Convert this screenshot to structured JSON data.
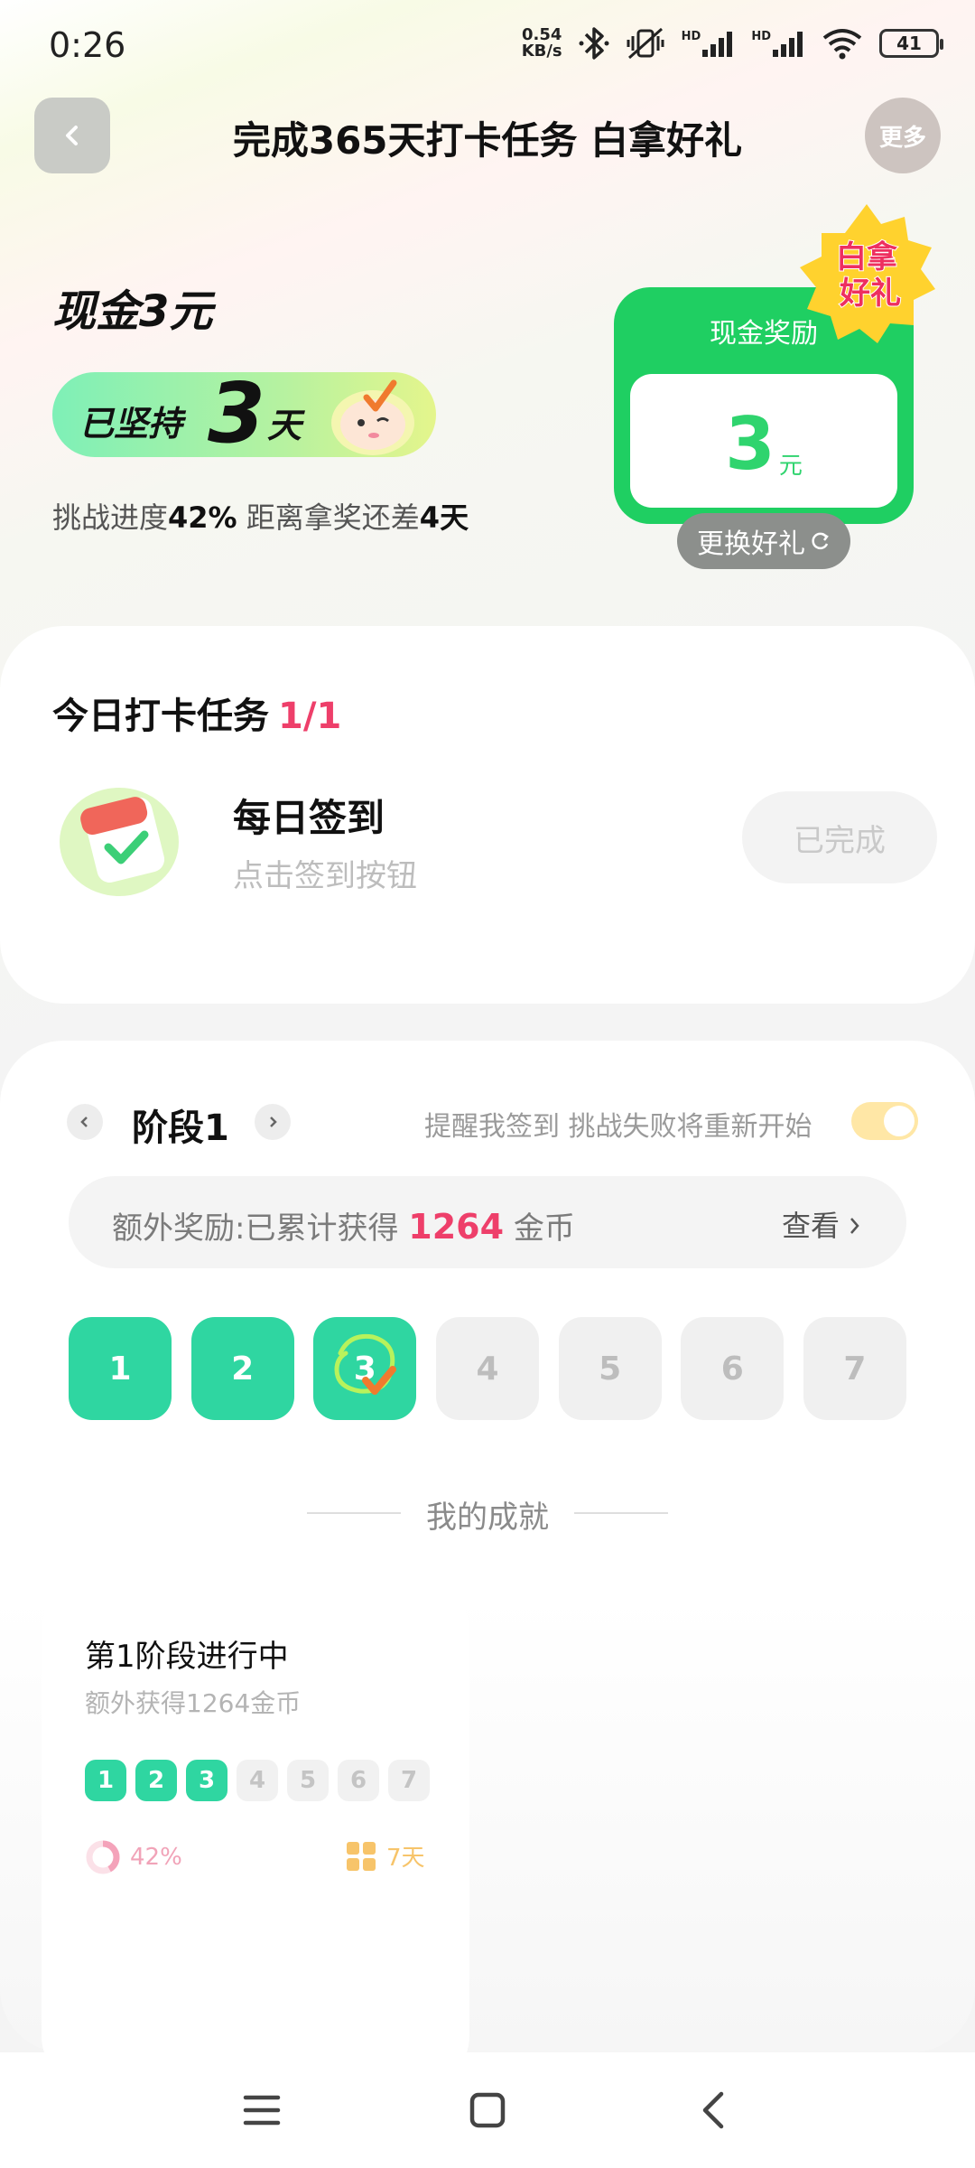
{
  "status_bar": {
    "time": "0:26",
    "net_speed_value": "0.54",
    "net_speed_unit": "KB/s",
    "hd1": "HD",
    "hd2": "HD",
    "battery": "41"
  },
  "header": {
    "title": "完成365天打卡任务 白拿好礼",
    "more_label": "更多"
  },
  "hero": {
    "cash_title": "现金3元",
    "persist_prefix": "已坚持",
    "persist_days": "3",
    "persist_unit": "天",
    "progress_prefix": "挑战进度",
    "progress_percent": "42%",
    "progress_mid": "距离拿奖还差",
    "days_left": "4天",
    "reward_label": "现金奖励",
    "reward_amount": "3",
    "reward_unit": "元",
    "badge_line1": "白拿",
    "badge_line2": "好礼",
    "swap_label": "更换好礼"
  },
  "task": {
    "heading": "今日打卡任务",
    "count": "1/1",
    "name": "每日签到",
    "desc": "点击签到按钮",
    "status_label": "已完成"
  },
  "stage": {
    "title": "阶段1",
    "remind_text": "提醒我签到 挑战失败将重新开始",
    "remind_on": true,
    "bonus_prefix": "额外奖励:已累计获得",
    "bonus_amount": "1264",
    "bonus_unit": "金币",
    "view_label": "查看",
    "days": [
      {
        "label": "1",
        "done": true
      },
      {
        "label": "2",
        "done": true
      },
      {
        "label": "3",
        "done": true
      },
      {
        "label": "4",
        "done": false
      },
      {
        "label": "5",
        "done": false
      },
      {
        "label": "6",
        "done": false
      },
      {
        "label": "7",
        "done": false
      }
    ]
  },
  "achievement": {
    "section_title": "我的成就",
    "card_title": "第1阶段进行中",
    "card_sub": "额外获得1264金币",
    "mini_days": [
      "1",
      "2",
      "3",
      "4",
      "5",
      "6",
      "7"
    ],
    "mini_done": 3,
    "percent": "42%",
    "progress": 0.42,
    "days_total": "7天"
  },
  "colors": {
    "accent_green": "#2fd6a1",
    "reward_green": "#1fcf62",
    "highlight_pink": "#ee3f6a"
  }
}
